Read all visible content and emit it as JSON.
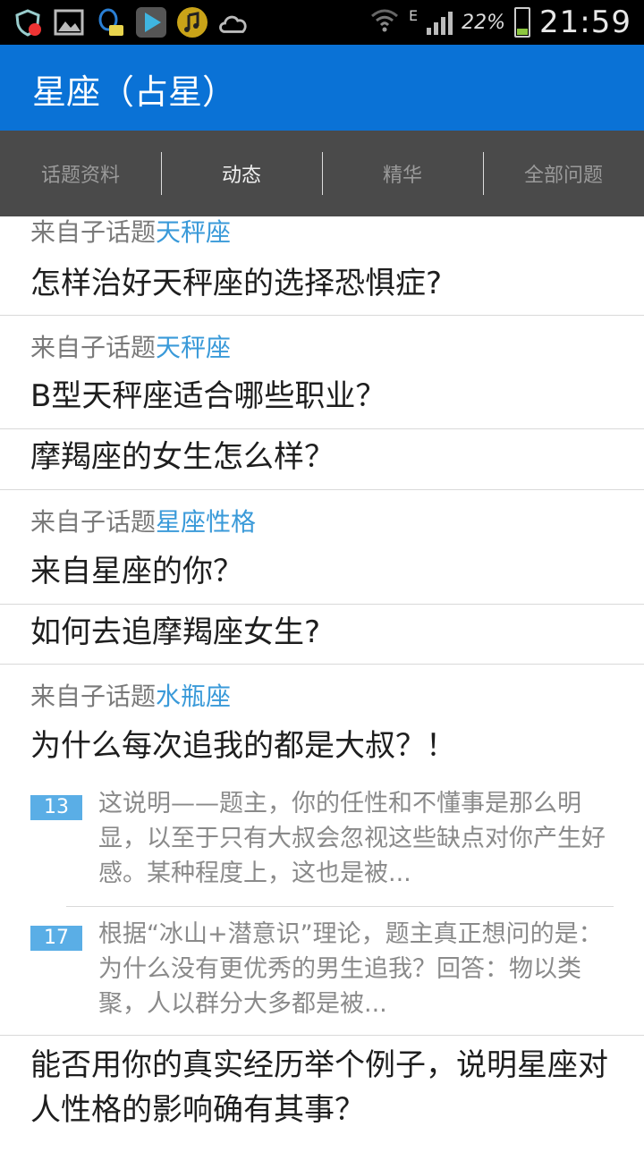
{
  "statusbar": {
    "icons": [
      "shield-ad-icon",
      "image-icon",
      "qq-notification-icon",
      "play-icon",
      "music-icon",
      "cloud-icon"
    ],
    "network": "E",
    "battery": "22%",
    "time": "21:59"
  },
  "appbar": {
    "title": "星座（占星）"
  },
  "tabs": [
    {
      "label": "话题资料"
    },
    {
      "label": "动态"
    },
    {
      "label": "精华"
    },
    {
      "label": "全部问题"
    }
  ],
  "feed": {
    "items": [
      {
        "from_prefix": "来自子话题",
        "topic": "天秤座",
        "question": "怎样治好天秤座的选择恐惧症?"
      },
      {
        "from_prefix": "来自子话题",
        "topic": "天秤座",
        "question": "B型天秤座适合哪些职业？"
      },
      {
        "question": "摩羯座的女生怎么样？"
      },
      {
        "from_prefix": "来自子话题",
        "topic": "星座性格",
        "question": "来自星座的你？"
      },
      {
        "question": "如何去追摩羯座女生?"
      },
      {
        "from_prefix": "来自子话题",
        "topic": "水瓶座",
        "question": "为什么每次追我的都是大叔？！",
        "answers": [
          {
            "votes": "13",
            "text": "这说明——题主，你的任性和不懂事是那么明显，以至于只有大叔会忽视这些缺点对你产生好感。某种程度上，这也是被..."
          },
          {
            "votes": "17",
            "text": "根据“冰山+潜意识”理论，题主真正想问的是：为什么没有更优秀的男生追我？回答：物以类聚，人以群分大多都是被..."
          }
        ]
      },
      {
        "question": "能否用你的真实经历举个例子，说明星座对人性格的影响确有其事？"
      }
    ]
  }
}
